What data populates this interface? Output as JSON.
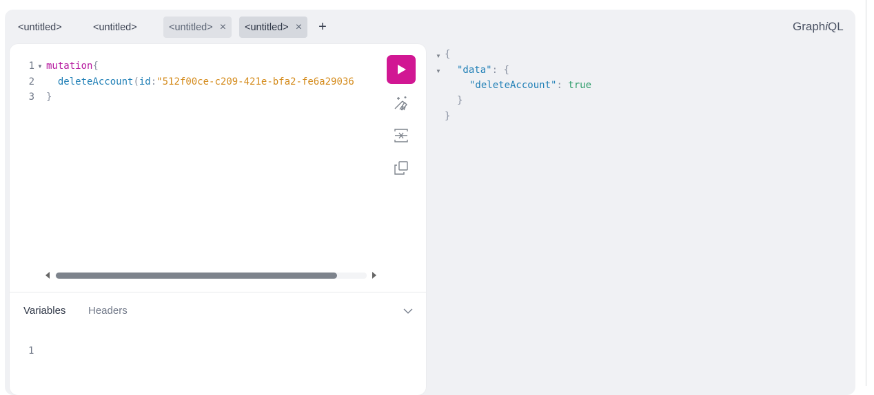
{
  "tabs": [
    {
      "label": "<untitled>",
      "closable": false,
      "active": false
    },
    {
      "label": "<untitled>",
      "closable": false,
      "active": false
    },
    {
      "label": "<untitled>",
      "closable": true,
      "active": false
    },
    {
      "label": "<untitled>",
      "closable": true,
      "active": true
    }
  ],
  "tab_close_glyph": "×",
  "add_tab_glyph": "+",
  "logo": {
    "prefix": "Graph",
    "italic": "i",
    "suffix": "QL"
  },
  "editor": {
    "line_numbers": [
      "1",
      "2",
      "3"
    ],
    "line1": {
      "keyword": "mutation",
      "brace": "{"
    },
    "line2": {
      "indent": "  ",
      "field": "deleteAccount",
      "paren": "(",
      "arg": "id",
      "colon": ":",
      "string": "\"512f00ce-c209-421e-bfa2-fe6a29036"
    },
    "line3": {
      "brace": "}"
    }
  },
  "toolbar": {
    "run": "play-icon",
    "prettify": "prettify-icon",
    "merge": "merge-fragments-icon",
    "copy": "copy-icon"
  },
  "bottom_tabs": {
    "variables": "Variables",
    "headers": "Headers"
  },
  "variables_editor": {
    "line_numbers": [
      "1"
    ]
  },
  "result": {
    "open_brace": "{",
    "data_key": "\"data\"",
    "colon": ": ",
    "data_open": "{",
    "field_key": "\"deleteAccount\"",
    "field_value": "true",
    "data_close": "}",
    "close_brace": "}"
  },
  "colors": {
    "run_button": "#d11793",
    "keyword": "#b5179e",
    "field": "#1f7fb6",
    "string": "#d48a1a",
    "boolean": "#2e9d6b"
  }
}
